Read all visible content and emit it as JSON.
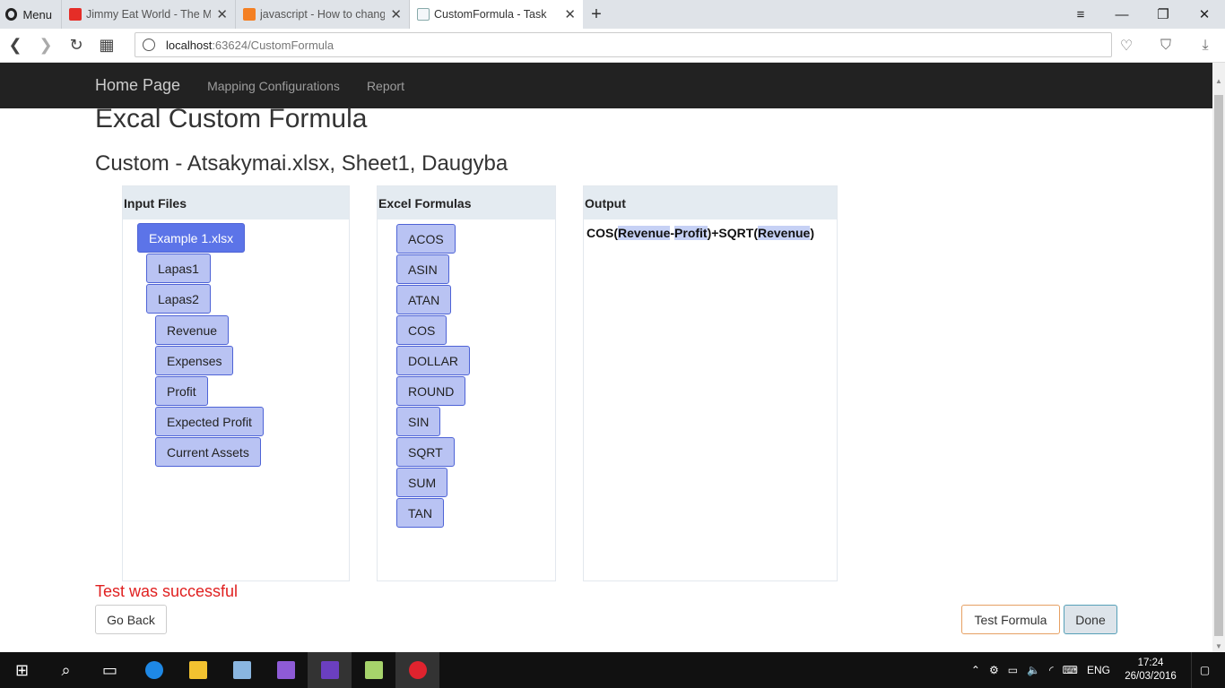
{
  "browser": {
    "menu_label": "Menu",
    "tabs": [
      {
        "title": "Jimmy Eat World - The Mid",
        "icon": "youtube-icon"
      },
      {
        "title": "javascript - How to change",
        "icon": "stackoverflow-icon"
      },
      {
        "title": "CustomFormula - Task",
        "icon": "page-icon"
      }
    ],
    "url_host": "localhost",
    "url_path": ":63624/CustomFormula"
  },
  "site": {
    "brand": "Home Page",
    "nav": [
      "Mapping Configurations",
      "Report"
    ]
  },
  "page": {
    "title": "Excal Custom Formula",
    "subtitle": "Custom - Atsakymai.xlsx, Sheet1, Daugyba"
  },
  "input_files": {
    "header": "Input Files",
    "file": "Example 1.xlsx",
    "sheets": [
      "Lapas1",
      "Lapas2"
    ],
    "columns": [
      "Revenue",
      "Expenses",
      "Profit",
      "Expected Profit",
      "Current Assets"
    ]
  },
  "excel_formulas": {
    "header": "Excel Formulas",
    "items": [
      "ACOS",
      "ASIN",
      "ATAN",
      "COS",
      "DOLLAR",
      "ROUND",
      "SIN",
      "SQRT",
      "SUM",
      "TAN"
    ]
  },
  "output": {
    "header": "Output",
    "tokens": [
      {
        "text": "COS(",
        "hl": false
      },
      {
        "text": "Revenue",
        "hl": true
      },
      {
        "text": "-",
        "hl": false
      },
      {
        "text": "Profit",
        "hl": true
      },
      {
        "text": ")+SQRT(",
        "hl": false
      },
      {
        "text": "Revenue",
        "hl": true
      },
      {
        "text": ")",
        "hl": false
      }
    ]
  },
  "status_message": "Test was successful",
  "buttons": {
    "back": "Go Back",
    "test": "Test Formula",
    "done": "Done"
  },
  "taskbar": {
    "language": "ENG",
    "time": "17:24",
    "date": "26/03/2016"
  },
  "colors": {
    "navbar_bg": "#222222",
    "chip_bg": "#b9c3f3",
    "chip_border": "#4e63d6",
    "file_chip_bg": "#5c74e8",
    "panel_header_bg": "#e4ebf1",
    "status_red": "#e02020"
  }
}
